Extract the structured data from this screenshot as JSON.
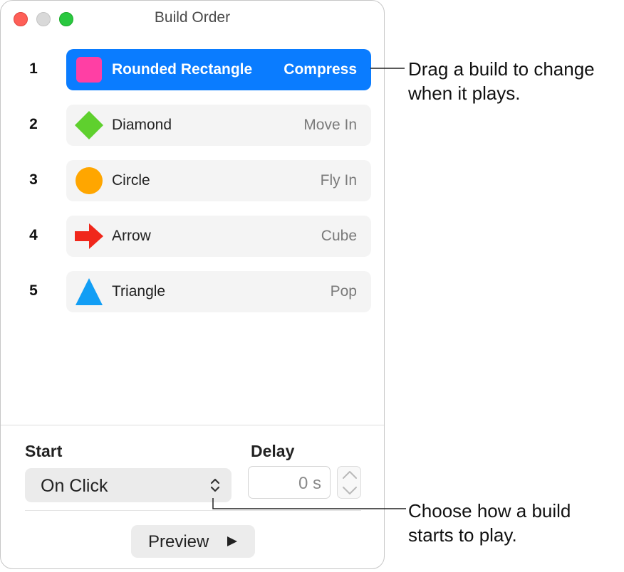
{
  "window": {
    "title": "Build Order",
    "traffic_lights": [
      "close",
      "minimize",
      "zoom"
    ]
  },
  "builds": [
    {
      "number": "1",
      "name": "Rounded Rectangle",
      "effect": "Compress",
      "icon": "rounded-square-icon",
      "icon_color": "#ff3fa4",
      "selected": true
    },
    {
      "number": "2",
      "name": "Diamond",
      "effect": "Move In",
      "icon": "diamond-icon",
      "icon_color": "#5fd02e",
      "selected": false
    },
    {
      "number": "3",
      "name": "Circle",
      "effect": "Fly In",
      "icon": "circle-icon",
      "icon_color": "#ffa600",
      "selected": false
    },
    {
      "number": "4",
      "name": "Arrow",
      "effect": "Cube",
      "icon": "arrow-icon",
      "icon_color": "#f0271b",
      "selected": false
    },
    {
      "number": "5",
      "name": "Triangle",
      "effect": "Pop",
      "icon": "triangle-icon",
      "icon_color": "#129ef5",
      "selected": false
    }
  ],
  "footer": {
    "start_label": "Start",
    "start_value": "On Click",
    "delay_label": "Delay",
    "delay_value": "0 s",
    "preview_label": "Preview"
  },
  "callouts": {
    "drag": [
      "Drag a build to change",
      "when it plays."
    ],
    "start": [
      "Choose how a build",
      "starts to play."
    ]
  },
  "colors": {
    "accent": "#0a7cff",
    "row_background": "#f4f4f4"
  }
}
